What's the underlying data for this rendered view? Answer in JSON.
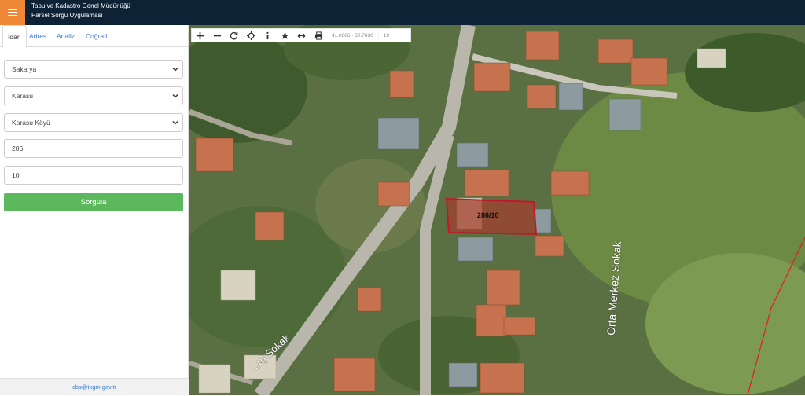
{
  "header": {
    "title_line1": "Tapu ve Kadastro Genel Müdürlüğü",
    "title_line2": "Parsel Sorgu Uygulaması",
    "menu_icon": "hamburger-icon",
    "menu_color": "#f0883a",
    "bg_color": "#0d2235"
  },
  "tabs": [
    {
      "label": "İdari",
      "active": true
    },
    {
      "label": "Adres",
      "active": false
    },
    {
      "label": "Analiz",
      "active": false
    },
    {
      "label": "Coğrafi",
      "active": false
    }
  ],
  "form": {
    "province": "Sakarya",
    "district": "Karasu",
    "neighborhood": "Karasu Köyü",
    "block": "286",
    "parcel": "10",
    "submit_label": "Sorgula",
    "submit_color": "#5cb85c"
  },
  "footer": {
    "email": "cbs@tkgm.gov.tr"
  },
  "toolbar": {
    "tools": [
      "zoom-in-icon",
      "zoom-out-icon",
      "refresh-icon",
      "locate-icon",
      "info-icon",
      "star-icon",
      "measure-icon",
      "print-icon"
    ],
    "coordinates": "41.0686 · 30.7830",
    "zoom_level": "19"
  },
  "map": {
    "parcel_label": "286/10",
    "street_labels": [
      "Orta Merkez Sokak",
      "...u) Sokak"
    ],
    "parcel_outline_color": "#c0182a"
  }
}
